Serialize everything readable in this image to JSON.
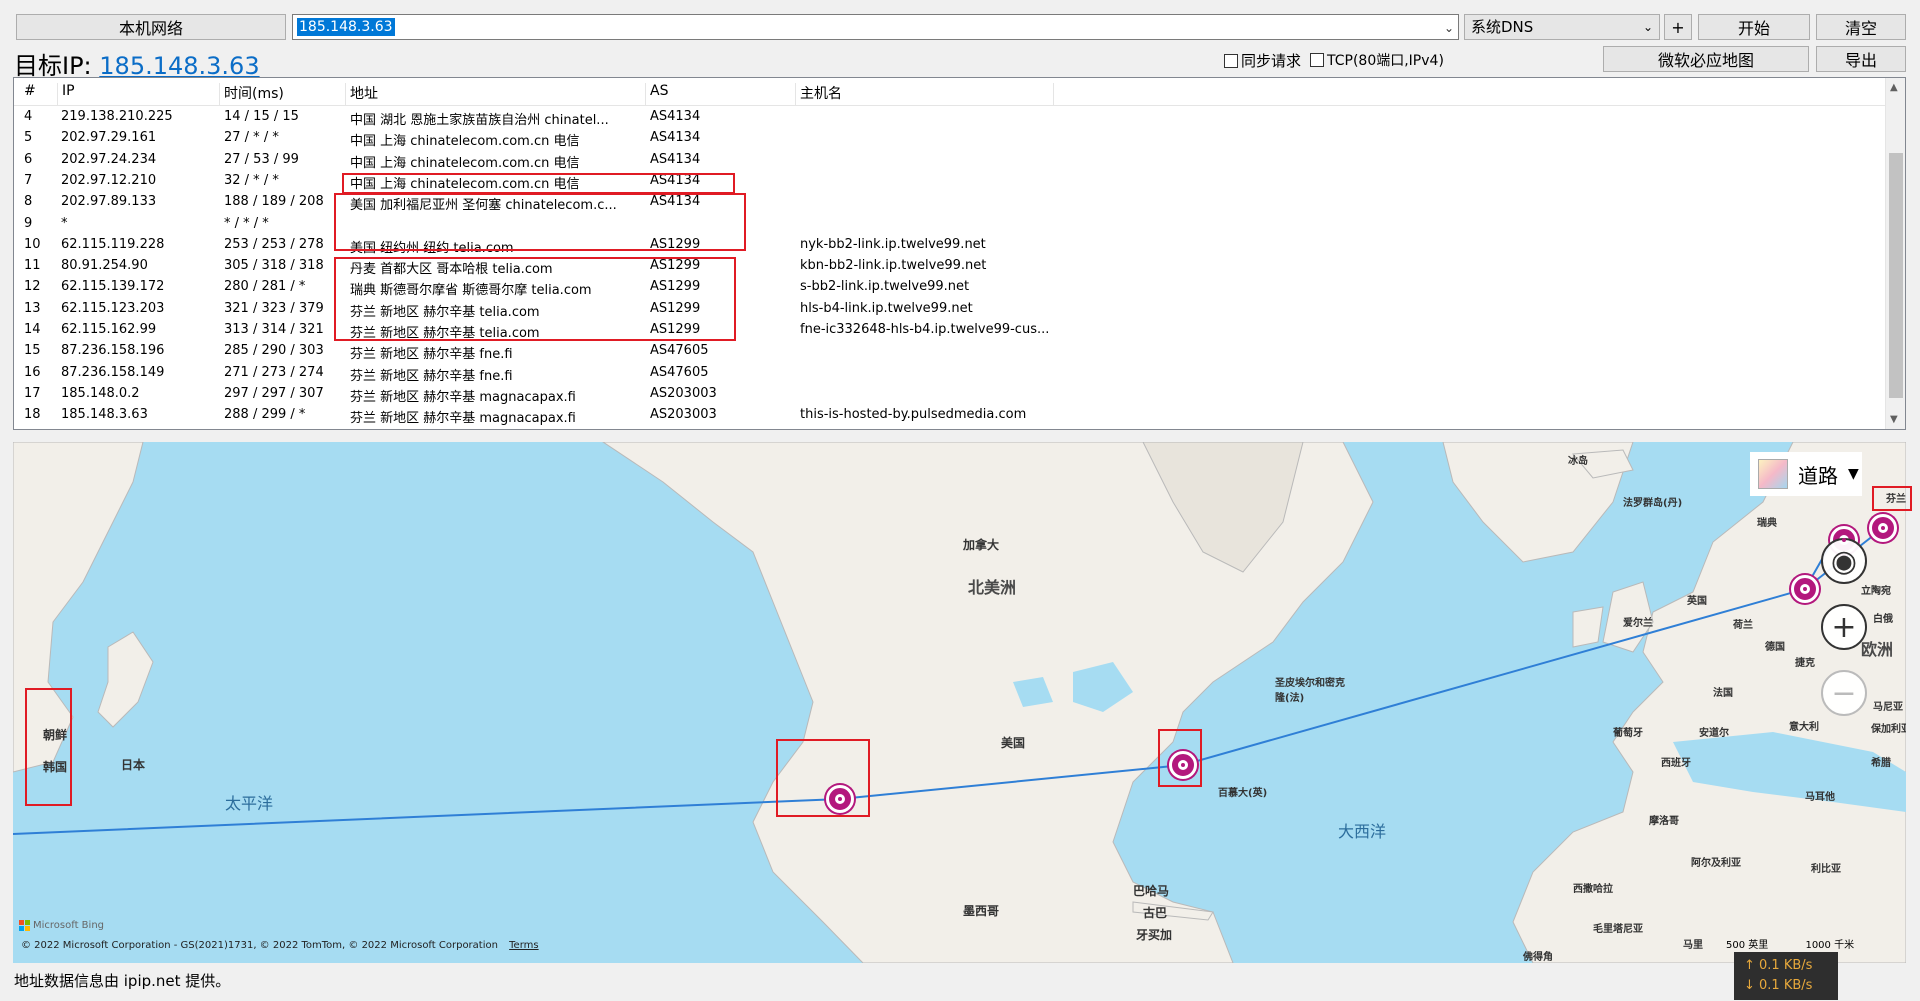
{
  "toolbar": {
    "local_network_label": "本机网络",
    "ip_input_value": "185.148.3.63",
    "dns_select_value": "系统DNS",
    "plus_label": "+",
    "start_label": "开始",
    "clear_label": "清空"
  },
  "target": {
    "label": "目标IP:",
    "ip": "185.148.3.63"
  },
  "options": {
    "sync_request_label": "同步请求",
    "tcp_label": "TCP(80端口,IPv4)",
    "bing_map_label": "微软必应地图",
    "export_label": "导出"
  },
  "table": {
    "headers": [
      "#",
      "IP",
      "时间(ms)",
      "地址",
      "AS",
      "主机名"
    ],
    "rows": [
      {
        "n": "4",
        "ip": "219.138.210.225",
        "time": "14 / 15 / 15",
        "addr": "中国 湖北 恩施土家族苗族自治州 chinatel...",
        "as": "AS4134",
        "host": ""
      },
      {
        "n": "5",
        "ip": "202.97.29.161",
        "time": "27 / * / *",
        "addr": "中国 上海 chinatelecom.com.cn 电信",
        "as": "AS4134",
        "host": ""
      },
      {
        "n": "6",
        "ip": "202.97.24.234",
        "time": "27 / 53 / 99",
        "addr": "中国 上海 chinatelecom.com.cn 电信",
        "as": "AS4134",
        "host": ""
      },
      {
        "n": "7",
        "ip": "202.97.12.210",
        "time": "32 / * / *",
        "addr": "中国 上海 chinatelecom.com.cn 电信",
        "as": "AS4134",
        "host": ""
      },
      {
        "n": "8",
        "ip": "202.97.89.133",
        "time": "188 / 189 / 208",
        "addr": "美国 加利福尼亚州 圣何塞 chinatelecom.c...",
        "as": "AS4134",
        "host": ""
      },
      {
        "n": "9",
        "ip": "*",
        "time": "* / * / *",
        "addr": "",
        "as": "",
        "host": ""
      },
      {
        "n": "10",
        "ip": "62.115.119.228",
        "time": "253 / 253 / 278",
        "addr": "美国 纽约州 纽约 telia.com",
        "as": "AS1299",
        "host": "nyk-bb2-link.ip.twelve99.net"
      },
      {
        "n": "11",
        "ip": "80.91.254.90",
        "time": "305 / 318 / 318",
        "addr": "丹麦 首都大区 哥本哈根 telia.com",
        "as": "AS1299",
        "host": "kbn-bb2-link.ip.twelve99.net"
      },
      {
        "n": "12",
        "ip": "62.115.139.172",
        "time": "280 / 281 / *",
        "addr": "瑞典 斯德哥尔摩省 斯德哥尔摩 telia.com",
        "as": "AS1299",
        "host": "s-bb2-link.ip.twelve99.net"
      },
      {
        "n": "13",
        "ip": "62.115.123.203",
        "time": "321 / 323 / 379",
        "addr": "芬兰 新地区 赫尔辛基 telia.com",
        "as": "AS1299",
        "host": "hls-b4-link.ip.twelve99.net"
      },
      {
        "n": "14",
        "ip": "62.115.162.99",
        "time": "313 / 314 / 321",
        "addr": "芬兰 新地区 赫尔辛基 telia.com",
        "as": "AS1299",
        "host": "fne-ic332648-hls-b4.ip.twelve99-cus..."
      },
      {
        "n": "15",
        "ip": "87.236.158.196",
        "time": "285 / 290 / 303",
        "addr": "芬兰 新地区 赫尔辛基 fne.fi",
        "as": "AS47605",
        "host": ""
      },
      {
        "n": "16",
        "ip": "87.236.158.149",
        "time": "271 / 273 / 274",
        "addr": "芬兰 新地区 赫尔辛基 fne.fi",
        "as": "AS47605",
        "host": ""
      },
      {
        "n": "17",
        "ip": "185.148.0.2",
        "time": "297 / 297 / 307",
        "addr": "芬兰 新地区 赫尔辛基 magnacapax.fi",
        "as": "AS203003",
        "host": ""
      },
      {
        "n": "18",
        "ip": "185.148.3.63",
        "time": "288 / 299 / *",
        "addr": "芬兰 新地区 赫尔辛基 magnacapax.fi",
        "as": "AS203003",
        "host": "this-is-hosted-by.pulsedmedia.com"
      }
    ]
  },
  "map": {
    "style_label": "道路",
    "labels": {
      "canada": "加拿大",
      "north_america": "北美洲",
      "usa": "美国",
      "pacific": "太平洋",
      "atlantic": "大西洋",
      "japan": "日本",
      "korea": "韩国",
      "north_korea": "朝鲜",
      "mexico": "墨西哥",
      "bahamas": "巴哈马",
      "cuba": "古巴",
      "jamaica": "牙买加",
      "bermuda": "百慕大(英)",
      "spm": "圣皮埃尔和密克隆(法)",
      "iceland": "冰岛",
      "faroe": "法罗群岛(丹)",
      "finland": "芬兰",
      "sweden_short": "瑞典",
      "uk": "英国",
      "ireland": "爱尔兰",
      "netherlands": "荷兰",
      "germany": "德国",
      "france": "法国",
      "czech": "捷克",
      "europe": "欧洲",
      "belarus": "白俄",
      "lithuania": "立陶宛",
      "andorra": "安道尔",
      "spain": "西班牙",
      "portugal": "葡萄牙",
      "italy": "意大利",
      "romania": "马尼亚",
      "bulgaria": "保加利亚",
      "greece": "希腊",
      "malta": "马耳他",
      "morocco": "摩洛哥",
      "algeria": "阿尔及利亚",
      "libya": "利比亚",
      "western_sahara": "西撒哈拉",
      "mauritania": "毛里塔尼亚",
      "mali": "马里",
      "cape_verde": "佛得角",
      "greenland": "冰岛"
    },
    "scale_500": "500 英里",
    "scale_1000": "1000 千米",
    "attribution": "© 2022 Microsoft Corporation - GS(2021)1731, © 2022 TomTom, © 2022 Microsoft Corporation",
    "terms": "Terms",
    "bing": "Microsoft Bing",
    "route_color": "#2f7fd6",
    "pin_color": "#b3187d"
  },
  "status": {
    "text": "地址数据信息由 ipip.net 提供。",
    "upload": "↑ 0.1 KB/s",
    "download": "↓ 0.1 KB/s"
  }
}
